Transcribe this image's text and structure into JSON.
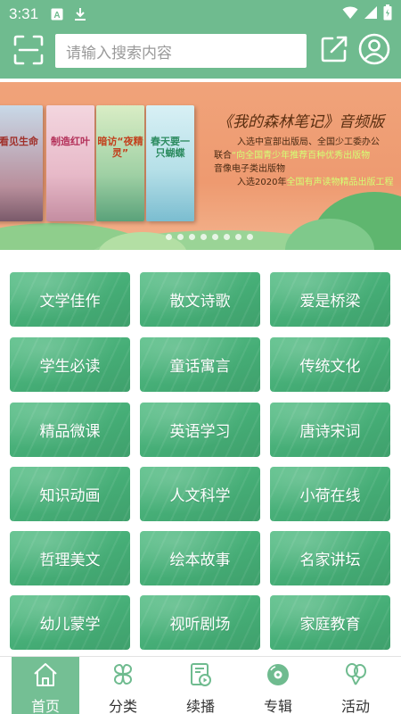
{
  "status_bar": {
    "time": "3:31",
    "icons": [
      "font-notification-icon",
      "download-icon",
      "wifi-icon",
      "signal-icon",
      "battery-icon"
    ]
  },
  "header": {
    "search_placeholder": "请输入搜索内容",
    "icons": [
      "scan-icon",
      "share-icon",
      "user-icon"
    ]
  },
  "banner": {
    "title": "《我的森林笔记》音频版",
    "lines": [
      {
        "pre": "入选中宣部出版局、全国少工委办公",
        "hl": "",
        "post": ""
      },
      {
        "pre": "联合",
        "hl": "“向全国青少年推荐百种优秀出版物",
        "post": ""
      },
      {
        "pre": "音像电子类出版物",
        "hl": "",
        "post": ""
      },
      {
        "pre": "入选2020年",
        "hl": "全国有声读物精品出版工程",
        "post": ""
      }
    ],
    "books": [
      {
        "title": "看见生命"
      },
      {
        "title": "制造红叶"
      },
      {
        "title": "暗访“夜精灵”"
      },
      {
        "title": "春天要一只蝴蝶"
      }
    ],
    "dot_count": 8
  },
  "categories": [
    "文学佳作",
    "散文诗歌",
    "爱是桥梁",
    "学生必读",
    "童话寓言",
    "传统文化",
    "精品微课",
    "英语学习",
    "唐诗宋词",
    "知识动画",
    "人文科学",
    "小荷在线",
    "哲理美文",
    "绘本故事",
    "名家讲坛",
    "幼儿蒙学",
    "视听剧场",
    "家庭教育"
  ],
  "bottom_nav": [
    {
      "label": "首页",
      "icon": "home-icon",
      "active": true
    },
    {
      "label": "分类",
      "icon": "clover-icon",
      "active": false
    },
    {
      "label": "续播",
      "icon": "resume-play-icon",
      "active": false
    },
    {
      "label": "专辑",
      "icon": "disc-icon",
      "active": false
    },
    {
      "label": "活动",
      "icon": "balloon-icon",
      "active": false
    }
  ],
  "colors": {
    "primary": "#6fbb8f",
    "tile": "#4caf7a",
    "nav_active": "#74bf94"
  }
}
